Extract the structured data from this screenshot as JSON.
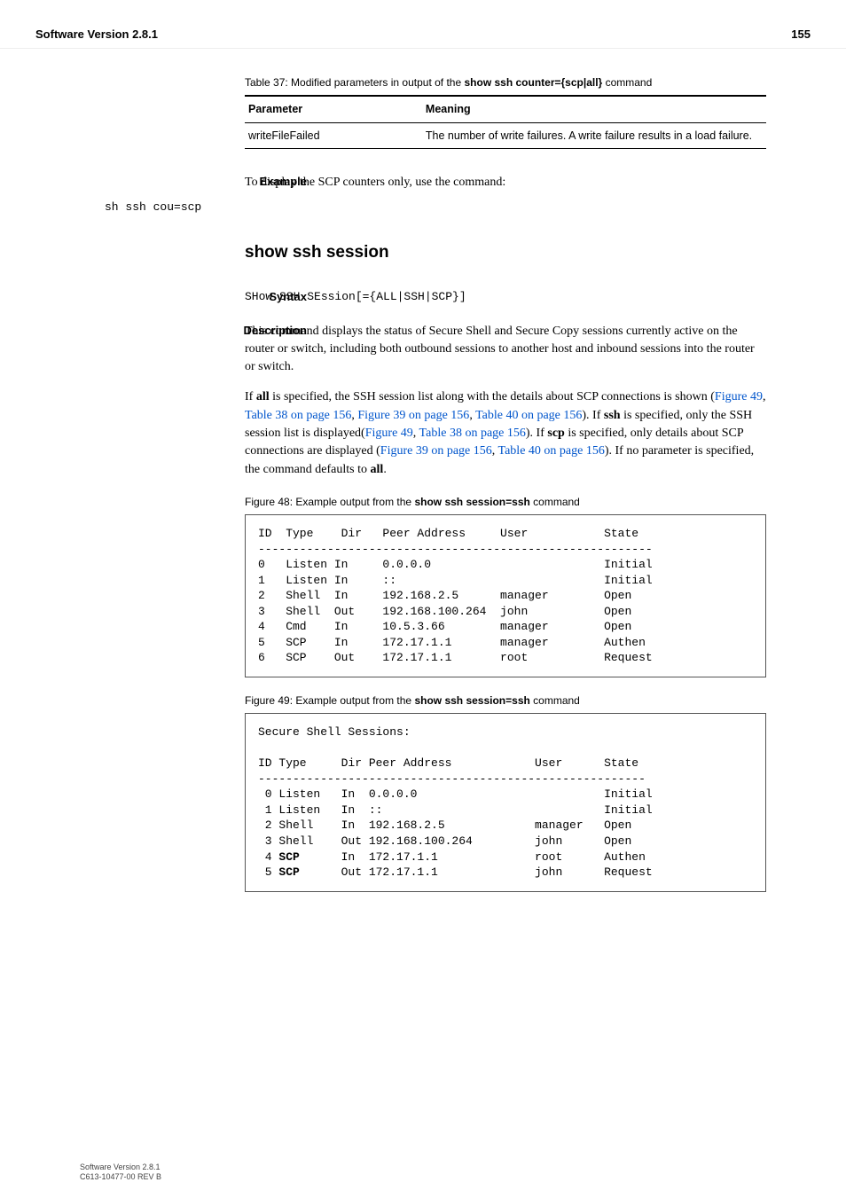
{
  "header": {
    "left": "Software Version 2.8.1",
    "right": "155"
  },
  "table37": {
    "caption_prefix": "Table 37: Modified parameters in output of the ",
    "caption_bold": "show ssh counter={scp|all}",
    "caption_suffix": " command",
    "col1": "Parameter",
    "col2": "Meaning",
    "row_param": "writeFileFailed",
    "row_meaning": "The number of write failures. A write failure results in a load failure."
  },
  "example": {
    "label": "Example",
    "text": "To display the SCP counters only, use the command:",
    "code": "sh ssh cou=scp"
  },
  "section_title": "show ssh session",
  "syntax": {
    "label": "Syntax",
    "code": "SHow SSH SEssion[={ALL|SSH|SCP}]"
  },
  "description": {
    "label": "Description",
    "para1": "This command displays the status of Secure Shell and Secure Copy sessions currently active on the router or switch, including both outbound sessions to another host and inbound sessions into the router or switch.",
    "p2_a": "If ",
    "p2_all": "all",
    "p2_b": " is specified, the SSH session list along with the details about SCP connections is shown (",
    "l1": "Figure 49",
    "p2_c": ", ",
    "l2": "Table 38 on page 156",
    "p2_d": ", ",
    "l3": "Figure 39 on page 156",
    "p2_e": ", ",
    "l4": "Table 40 on page 156",
    "p2_f": "). If ",
    "p2_ssh": "ssh",
    "p2_g": " is specified, only the SSH session list is displayed(",
    "l5": "Figure 49",
    "p2_h": ", ",
    "l6": "Table 38 on page 156",
    "p2_i": "). If ",
    "p2_scp": "scp",
    "p2_j": " is specified, only details about SCP connections are displayed (",
    "l7": "Figure 39 on page 156",
    "p2_k": ", ",
    "l8": "Table 40 on page 156",
    "p2_l": "). If no parameter is specified, the command defaults to ",
    "p2_all2": "all",
    "p2_m": "."
  },
  "fig48": {
    "caption_prefix": "Figure 48: Example output from the ",
    "caption_bold": "show ssh session=ssh",
    "caption_suffix": " command",
    "pre": "ID  Type    Dir   Peer Address     User           State\n---------------------------------------------------------\n0   Listen In     0.0.0.0                         Initial\n1   Listen In     ::                              Initial\n2   Shell  In     192.168.2.5      manager        Open\n3   Shell  Out    192.168.100.264  john           Open\n4   Cmd    In     10.5.3.66        manager        Open\n5   SCP    In     172.17.1.1       manager        Authen\n6   SCP    Out    172.17.1.1       root           Request"
  },
  "fig49": {
    "caption_prefix": "Figure 49: Example output from the ",
    "caption_bold": "show ssh session=ssh",
    "caption_suffix": " command",
    "line0": "Secure Shell Sessions:",
    "line_hdr": "ID Type     Dir Peer Address            User      State",
    "line_sep": "--------------------------------------------------------",
    "r0": " 0 Listen   In  0.0.0.0                           Initial",
    "r1": " 1 Listen   In  ::                                Initial",
    "r2": " 2 Shell    In  192.168.2.5             manager   Open",
    "r3": " 3 Shell    Out 192.168.100.264         john      Open",
    "r4a": " 4 ",
    "r4bold": "SCP",
    "r4b": "      In  172.17.1.1              root      Authen",
    "r5a": " 5 ",
    "r5bold": "SCP",
    "r5b": "      Out 172.17.1.1              john      Request"
  },
  "footer": {
    "l1": "Software Version 2.8.1",
    "l2": "C613-10477-00 REV B"
  }
}
